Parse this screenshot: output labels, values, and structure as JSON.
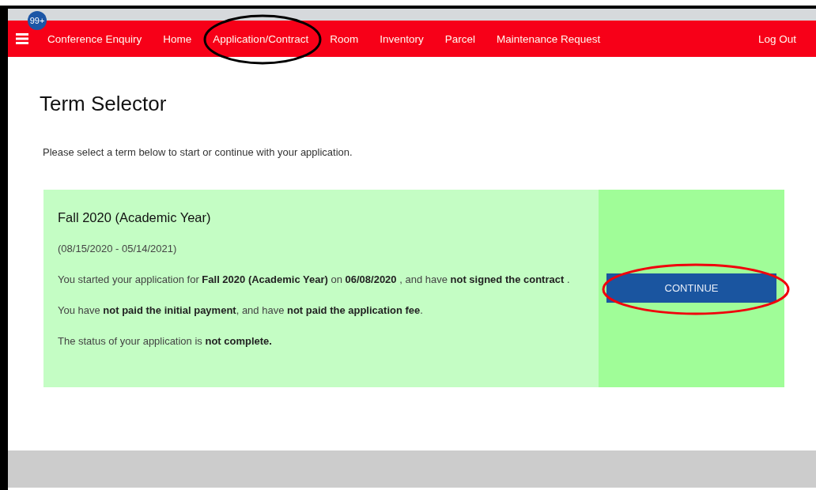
{
  "nav": {
    "badge": "99+",
    "items": [
      {
        "label": "Conference Enquiry",
        "circled": false
      },
      {
        "label": "Home",
        "circled": false
      },
      {
        "label": "Application/Contract",
        "circled": true
      },
      {
        "label": "Room",
        "circled": false
      },
      {
        "label": "Inventory",
        "circled": false
      },
      {
        "label": "Parcel",
        "circled": false
      },
      {
        "label": "Maintenance Request",
        "circled": false
      }
    ],
    "logout": "Log Out"
  },
  "page": {
    "title": "Term Selector",
    "intro": "Please select a term below to start or continue with your application."
  },
  "term": {
    "title": "Fall 2020 (Academic Year)",
    "dates": "(08/15/2020 - 05/14/2021)",
    "lines": [
      "You started your application for **Fall 2020 (Academic Year)** on **06/08/2020** , and have **not signed the contract** .",
      "You have **not paid the initial payment**, and have **not paid the application fee**.",
      "The status of your application is **not complete.**"
    ],
    "button": {
      "label": "CONTINUE",
      "circled": true
    }
  }
}
